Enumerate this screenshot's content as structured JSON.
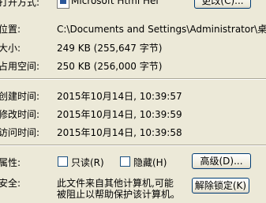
{
  "open_with": {
    "label": "打开方式:",
    "value": "Microsoft Html Hel",
    "change_button": "更改(C)..."
  },
  "location": {
    "label": "位置:",
    "value": "C:\\Documents and Settings\\Administrator\\桌"
  },
  "size": {
    "label": "大小:",
    "value": "249 KB (255,647 字节)"
  },
  "size_on_disk": {
    "label": "占用空间:",
    "value": "250 KB (256,000 字节)"
  },
  "created": {
    "label": "创建时间:",
    "value": "2015年10月14日, 10:39:57"
  },
  "modified": {
    "label": "修改时间:",
    "value": "2015年10月14日, 10:39:59"
  },
  "accessed": {
    "label": "访问时间:",
    "value": "2015年10月14日, 10:39:58"
  },
  "attributes": {
    "label": "属性:",
    "readonly": "只读(R)",
    "hidden": "隐藏(H)",
    "advanced_button": "高级(D)..."
  },
  "security": {
    "label": "安全:",
    "message_line1": "此文件来自其他计算机,可能",
    "message_line2": "被阻止以帮助保护该计算机。",
    "unblock_button": "解除锁定(K)"
  }
}
